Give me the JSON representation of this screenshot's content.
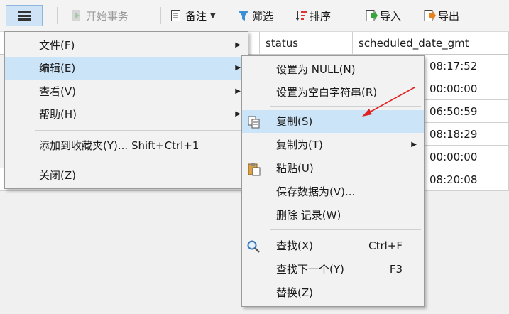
{
  "toolbar": {
    "start_transaction": "开始事务",
    "memo": "备注",
    "filter": "筛选",
    "sort": "排序",
    "import": "导入",
    "export": "导出"
  },
  "grid": {
    "headers": [
      "status",
      "scheduled_date_gmt"
    ],
    "times": [
      "08:17:52",
      "00:00:00",
      "06:50:59",
      "08:18:29",
      "00:00:00",
      "08:20:08"
    ]
  },
  "main_menu": {
    "items": [
      {
        "label": "文件(F)"
      },
      {
        "label": "编辑(E)"
      },
      {
        "label": "查看(V)"
      },
      {
        "label": "帮助(H)"
      },
      {
        "label": "添加到收藏夹(Y)... Shift+Ctrl+1"
      },
      {
        "label": "关闭(Z)"
      }
    ]
  },
  "edit_menu": {
    "items": [
      {
        "label": "设置为 NULL(N)"
      },
      {
        "label": "设置为空白字符串(R)"
      },
      {
        "label": "复制(S)"
      },
      {
        "label": "复制为(T)"
      },
      {
        "label": "粘贴(U)"
      },
      {
        "label": "保存数据为(V)..."
      },
      {
        "label": "删除 记录(W)"
      },
      {
        "label": "查找(X)",
        "shortcut": "Ctrl+F"
      },
      {
        "label": "查找下一个(Y)",
        "shortcut": "F3"
      },
      {
        "label": "替换(Z)"
      }
    ]
  },
  "colors": {
    "highlight": "#cce4f7",
    "annotation_arrow": "#e02020"
  }
}
